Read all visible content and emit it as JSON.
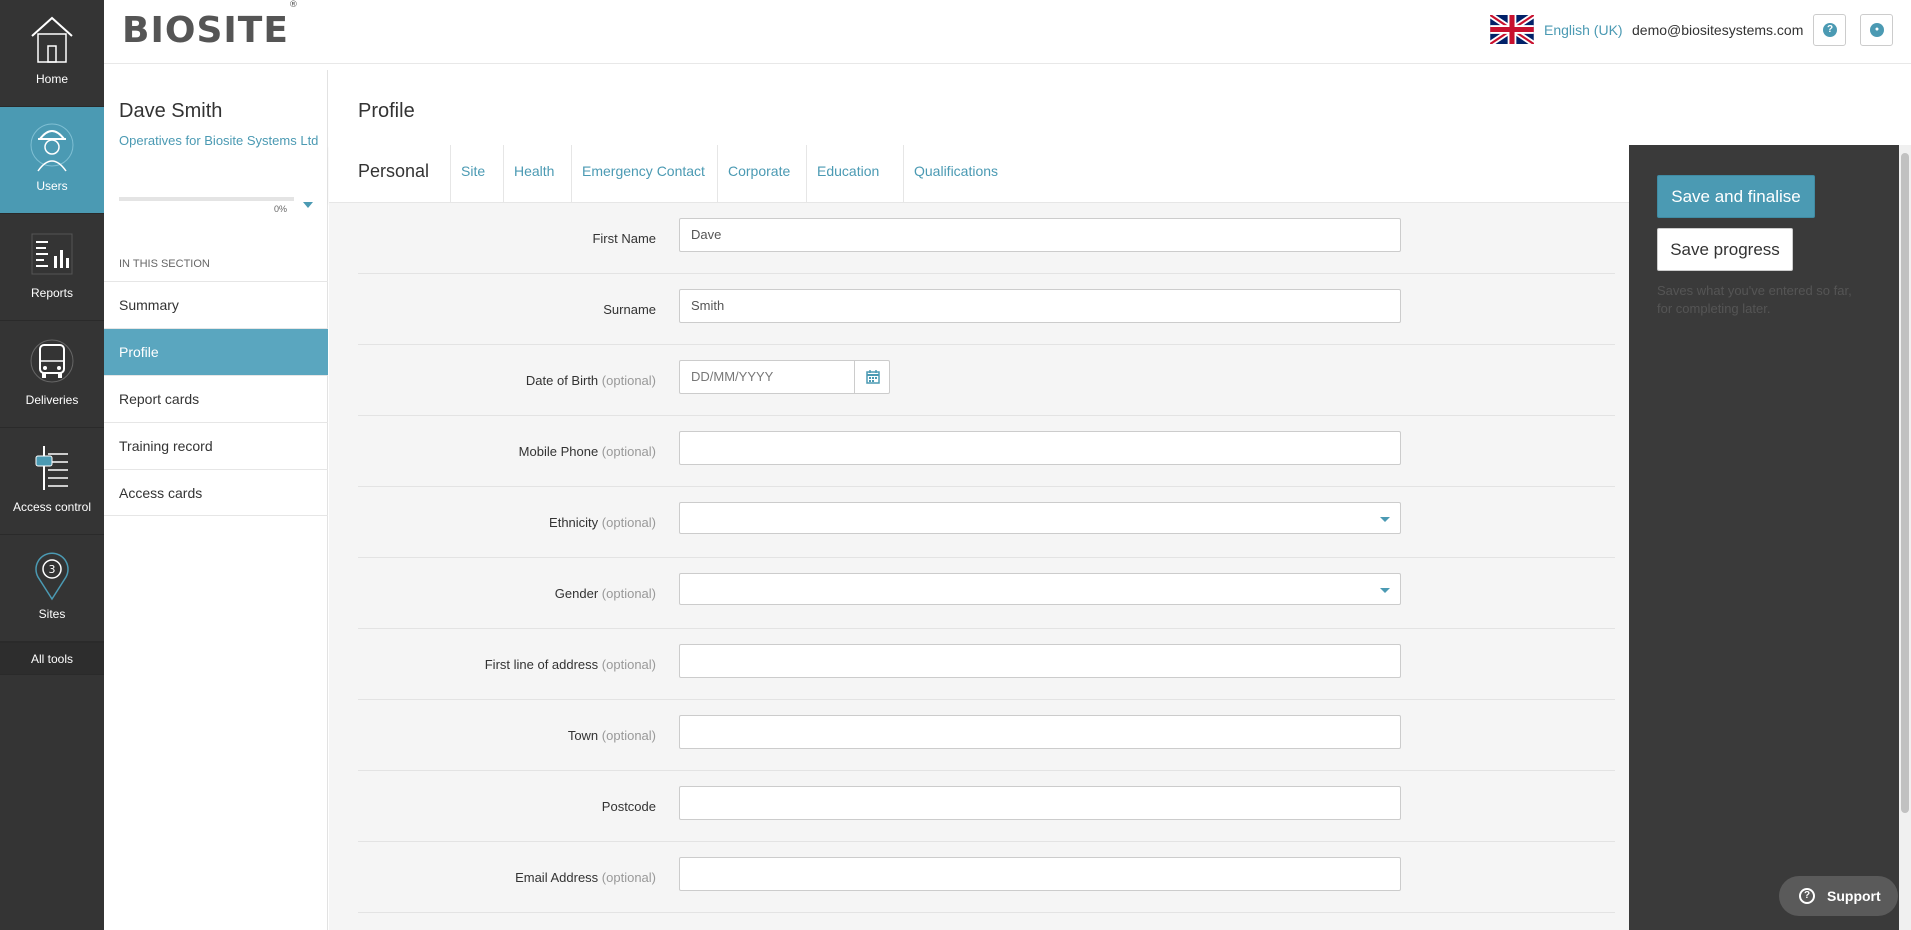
{
  "nav": {
    "items": [
      {
        "label": "Home",
        "icon": "home-icon"
      },
      {
        "label": "Users",
        "icon": "worker-icon"
      },
      {
        "label": "Reports",
        "icon": "reports-icon"
      },
      {
        "label": "Deliveries",
        "icon": "bus-icon"
      },
      {
        "label": "Access control",
        "icon": "access-control-icon"
      },
      {
        "label": "Sites",
        "icon": "map-pin-icon",
        "badge": "3"
      }
    ],
    "all_tools": "All tools",
    "active_color": "#4b9ab3"
  },
  "header": {
    "logo": "BIOSITE",
    "logo_mark": "®",
    "language": "English (UK)",
    "email": "demo@biositesystems.com",
    "help_glyph": "?",
    "account_glyph": "●"
  },
  "sidebar": {
    "name": "Dave Smith",
    "org": "Operatives for Biosite Systems Ltd",
    "progress_label": "0%",
    "progress_value": 0,
    "section_title": "IN THIS SECTION",
    "items": [
      {
        "label": "Summary"
      },
      {
        "label": "Profile"
      },
      {
        "label": "Report cards"
      },
      {
        "label": "Training record"
      },
      {
        "label": "Access cards"
      }
    ]
  },
  "main": {
    "title": "Profile",
    "tabs": [
      {
        "label": "Personal"
      },
      {
        "label": "Site"
      },
      {
        "label": "Health"
      },
      {
        "label": "Emergency Contact"
      },
      {
        "label": "Corporate"
      },
      {
        "label": "Education"
      },
      {
        "label": "Qualifications"
      }
    ],
    "optional_text": "(optional)",
    "form": {
      "first_name": {
        "label": "First Name",
        "value": "Dave"
      },
      "surname": {
        "label": "Surname",
        "value": "Smith"
      },
      "dob": {
        "label": "Date of Birth",
        "placeholder": "DD/MM/YYYY"
      },
      "mobile": {
        "label": "Mobile Phone",
        "value": ""
      },
      "ethnicity": {
        "label": "Ethnicity",
        "value": ""
      },
      "gender": {
        "label": "Gender",
        "value": ""
      },
      "address1": {
        "label": "First line of address",
        "value": ""
      },
      "town": {
        "label": "Town",
        "value": ""
      },
      "postcode": {
        "label": "Postcode",
        "value": ""
      },
      "email": {
        "label": "Email Address",
        "value": ""
      }
    }
  },
  "actions": {
    "save_finalise": "Save and finalise",
    "save_progress": "Save progress",
    "hint": "Saves what you've entered so far, for completing later.",
    "support": "Support",
    "support_glyph": "?"
  }
}
